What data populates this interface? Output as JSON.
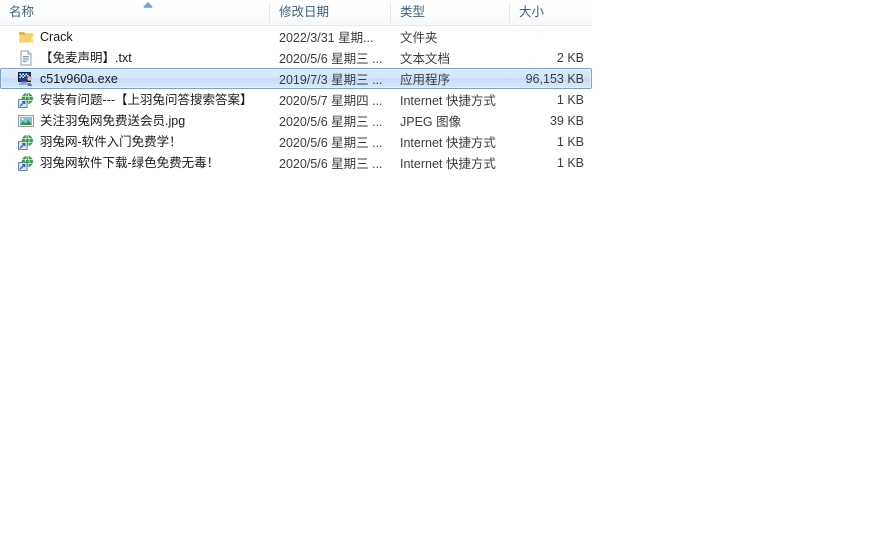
{
  "window": {
    "title": "Crack"
  },
  "columns": [
    {
      "key": "name",
      "label": "名称",
      "sorted": true,
      "sort_direction": "ascending"
    },
    {
      "key": "date",
      "label": "修改日期",
      "sorted": false
    },
    {
      "key": "type",
      "label": "类型",
      "sorted": false
    },
    {
      "key": "size",
      "label": "大小",
      "sorted": false
    }
  ],
  "files": [
    {
      "name": "Crack",
      "date": "2022/3/31 星期...",
      "type": "文件夹",
      "size": "",
      "icon": "folder-icon",
      "selected": false
    },
    {
      "name": "【免麦声明】.txt",
      "date": "2020/5/6 星期三 ...",
      "type": "文本文档",
      "size": "2 KB",
      "icon": "text-document-icon",
      "selected": false
    },
    {
      "name": "c51v960a.exe",
      "date": "2019/7/3 星期三 ...",
      "type": "应用程序",
      "size": "96,153 KB",
      "icon": "application-setup-icon",
      "selected": true
    },
    {
      "name": "安装有问题---【上羽兔问答搜索答案】",
      "date": "2020/5/7 星期四 ...",
      "type": "Internet 快捷方式",
      "size": "1 KB",
      "icon": "internet-shortcut-icon",
      "selected": false
    },
    {
      "name": "关注羽兔网免费送会员.jpg",
      "date": "2020/5/6 星期三 ...",
      "type": "JPEG 图像",
      "size": "39 KB",
      "icon": "jpeg-image-icon",
      "selected": false
    },
    {
      "name": "羽兔网-软件入门免费学！",
      "date": "2020/5/6 星期三 ...",
      "type": "Internet 快捷方式",
      "size": "1 KB",
      "icon": "internet-shortcut-icon",
      "selected": false
    },
    {
      "name": "羽兔网软件下载-绿色免费无毒！",
      "date": "2020/5/6 星期三 ...",
      "type": "Internet 快捷方式",
      "size": "1 KB",
      "icon": "internet-shortcut-icon",
      "selected": false
    }
  ],
  "colors": {
    "selection_fill": "#d2e5fa",
    "selection_border": "#7da2ce",
    "header_text": "#41607d",
    "row_text": "#1a1a1a",
    "folder_gold": "#f5c75b",
    "sort_arrow": "#6b9fd4"
  }
}
